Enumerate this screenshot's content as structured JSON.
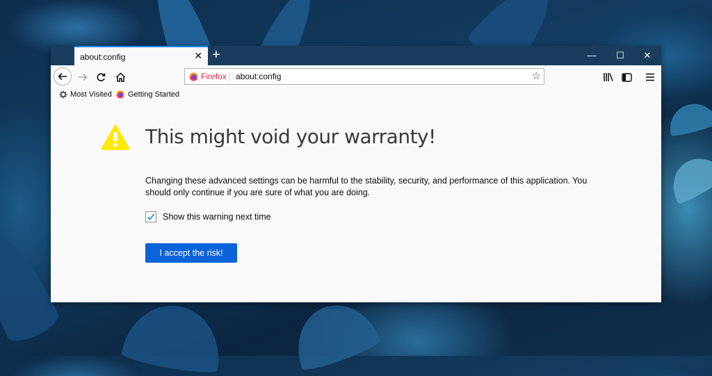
{
  "tab": {
    "title": "about:config",
    "close_icon": "close-icon",
    "new_tab_icon": "plus-icon"
  },
  "window_controls": {
    "minimize_icon": "minimize-icon",
    "maximize_icon": "maximize-icon",
    "close_icon": "close-icon"
  },
  "navbar": {
    "back_icon": "arrow-left-icon",
    "forward_icon": "arrow-right-icon",
    "reload_icon": "reload-icon",
    "home_icon": "home-icon",
    "url": {
      "identity_label": "Firefox",
      "value": "about:config"
    },
    "bookmark_icon": "star-icon",
    "library_icon": "library-icon",
    "sidebar_icon": "sidebar-icon",
    "menu_icon": "hamburger-menu-icon"
  },
  "bookmarks": [
    {
      "label": "Most Visited",
      "icon": "gear-icon"
    },
    {
      "label": "Getting Started",
      "icon": "firefox-icon"
    }
  ],
  "warning": {
    "icon": "warning-icon",
    "title": "This might void your warranty!",
    "description": "Changing these advanced settings can be harmful to the stability, security, and performance of this application. You should only continue if you are sure of what you are doing.",
    "checkbox_label": "Show this warning next time",
    "checkbox_checked": true,
    "button_label": "I accept the risk!"
  },
  "colors": {
    "accent": "#0a63d8",
    "titlebar": "#1a3d5d",
    "warning": "#ffe900",
    "firefox_label": "#d7264c"
  }
}
